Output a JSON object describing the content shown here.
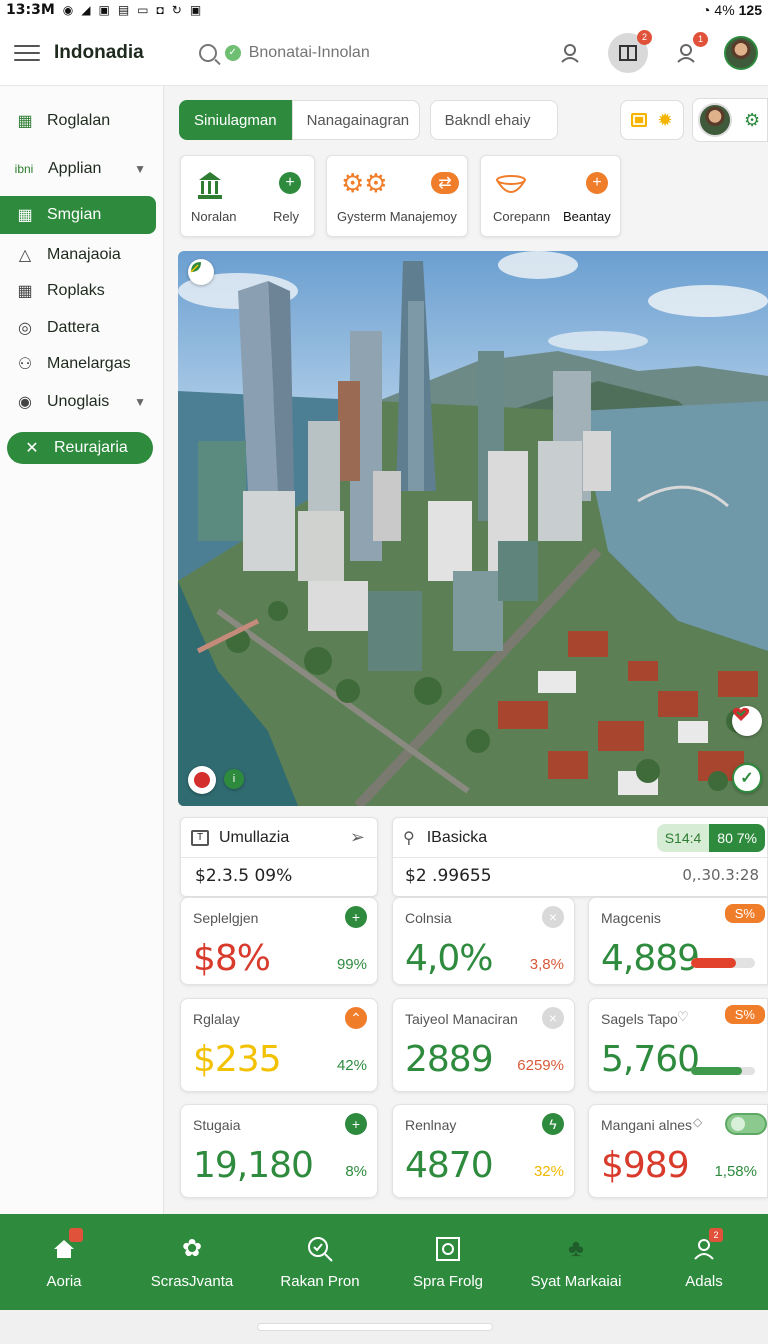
{
  "status_bar": {
    "time": "13:3M",
    "battery": "125",
    "signal": "4%"
  },
  "header": {
    "brand": "Indonadia",
    "search_placeholder": "Bnonatai-Innolan",
    "notif_badge_1": "2",
    "notif_badge_2": "1"
  },
  "sidebar": {
    "items": [
      {
        "label": "Roglalan",
        "icon": "grid-icon"
      },
      {
        "label": "Applian",
        "icon": "app-icon",
        "prefix": "ibni"
      },
      {
        "label": "Smgian",
        "icon": "grid-icon",
        "active": true
      },
      {
        "label": "Manajaoia",
        "icon": "triangle-icon"
      },
      {
        "label": "Roplaks",
        "icon": "grid-icon"
      },
      {
        "label": "Dattera",
        "icon": "wave-icon"
      },
      {
        "label": "Manelargas",
        "icon": "people-icon"
      },
      {
        "label": "Unoglais",
        "icon": "circle-icon"
      },
      {
        "label": "Reurajaria",
        "icon": "tools-icon"
      }
    ]
  },
  "tabs": [
    {
      "label": "Siniulagman"
    },
    {
      "label": "Nanagainagran"
    },
    {
      "label": "Bakndl ehaiy"
    }
  ],
  "quick_cards": [
    {
      "label_left": "Noralan",
      "label_right": "Rely",
      "icon": "building-icon"
    },
    {
      "label": "Gysterm Manajemoy",
      "icon": "gears-icon"
    },
    {
      "label_left": "Corepann",
      "label_right": "Beantay",
      "icon": "bowl-icon"
    }
  ],
  "panels": {
    "left": {
      "title": "Umullazia",
      "amount": "$2.3.5 09%"
    },
    "right": {
      "title": "IBasicka",
      "amount": "$2 .99655",
      "amount_right": "0,.30.3:28",
      "chip_a": "S14:4",
      "chip_b": "80 7%"
    }
  },
  "metrics": [
    {
      "title": "Seplelgjen",
      "value": "$8%",
      "small": "99%",
      "value_color": "#d83a2c",
      "small_color": "#2e8b3e"
    },
    {
      "title": "Colnsia",
      "value": "4,0%",
      "small": "3,8%",
      "value_color": "#2e8b3e",
      "small_color": "#d85a3a"
    },
    {
      "title": "Magcenis",
      "value": "4,889",
      "pill": "S%",
      "bar_fill": 0.7,
      "bar_color": "#e2422c",
      "value_color": "#2e8b3e"
    },
    {
      "title": "Rglalay",
      "value": "$235",
      "small": "42%",
      "value_color": "#f2c200",
      "small_color": "#2e8b3e"
    },
    {
      "title": "Taiyeol Manaciran",
      "value": "2889",
      "small": "6259%",
      "value_color": "#2e8b3e",
      "small_color": "#d85a3a"
    },
    {
      "title": "Sagels Tapo",
      "value": "5,760",
      "pill": "S%",
      "bar_fill": 0.8,
      "bar_color": "#3e9a4a",
      "value_color": "#2e8b3e"
    },
    {
      "title": "Stugaia",
      "value": "19,180",
      "small": "8%",
      "value_color": "#2e8b3e",
      "small_color": "#2e8b3e"
    },
    {
      "title": "Renlnay",
      "value": "4870",
      "small": "32%",
      "value_color": "#2e8b3e",
      "small_color": "#f2b800"
    },
    {
      "title": "Mangani alnes",
      "value": "$989",
      "small": "1,58%",
      "value_color": "#d83a2c",
      "small_color": "#2e8b3e"
    }
  ],
  "bottom_nav": [
    {
      "label": "Aoria",
      "icon": "home-icon",
      "badge": ""
    },
    {
      "label": "ScrasJvanta",
      "icon": "flower-icon"
    },
    {
      "label": "Rakan Pron",
      "icon": "search-check-icon"
    },
    {
      "label": "Spra Frolg",
      "icon": "frame-icon"
    },
    {
      "label": "Syat Markaiai",
      "icon": "plant-icon"
    },
    {
      "label": "Adals",
      "icon": "user-icon",
      "badge": "2"
    }
  ],
  "colors": {
    "primary": "#2e8b3e",
    "accent_orange": "#f07d2a",
    "accent_red": "#d83a2c",
    "accent_yellow": "#f2c200"
  }
}
